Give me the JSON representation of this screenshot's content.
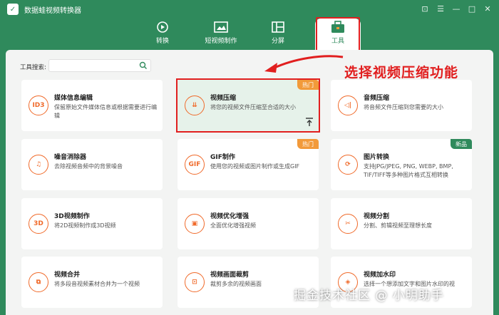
{
  "app": {
    "title": "数据蛙视频转换器",
    "logo_glyph": "✓"
  },
  "window_controls": [
    "⊡",
    "☰",
    "—",
    "□",
    "✕"
  ],
  "nav_tabs": [
    {
      "label": "转换",
      "icon": "convert-icon"
    },
    {
      "label": "短视频制作",
      "icon": "short-video-icon"
    },
    {
      "label": "分屏",
      "icon": "split-screen-icon"
    },
    {
      "label": "工具",
      "icon": "toolbox-icon",
      "active": true
    }
  ],
  "search": {
    "label": "工具搜索:",
    "placeholder": ""
  },
  "annotation": "选择视频压缩功能",
  "tools": [
    {
      "title": "媒体信息编辑",
      "desc": "保留原始文件媒体信息或根据需要进行编辑",
      "icon_text": "ID3"
    },
    {
      "title": "视频压缩",
      "desc": "将您的视频文件压缩至合适的大小",
      "icon_text": "⇊",
      "badge": "热门",
      "highlight": true
    },
    {
      "title": "音频压缩",
      "desc": "将音频文件压缩到您需要的大小",
      "icon_text": "◁|"
    },
    {
      "title": "噪音消除器",
      "desc": "去除视频音频中的背景噪音",
      "icon_text": "♫"
    },
    {
      "title": "GIF制作",
      "desc": "使用您的视频或图片制作或生成GIF",
      "icon_text": "GIF",
      "badge": "热门"
    },
    {
      "title": "图片转换",
      "desc": "支持JPG/JPEG, PNG, WEBP, BMP, TIF/TIFF等多种图片格式互相转换",
      "icon_text": "⟳",
      "badge": "新品"
    },
    {
      "title": "3D视频制作",
      "desc": "将2D视频制作成3D视频",
      "icon_text": "3D"
    },
    {
      "title": "视频优化增强",
      "desc": "全面优化增强视频",
      "icon_text": "▣"
    },
    {
      "title": "视频分割",
      "desc": "分割、剪辑视频至理想长度",
      "icon_text": "✂"
    },
    {
      "title": "视频合并",
      "desc": "将多段音视频素材合并为一个视频",
      "icon_text": "⧉"
    },
    {
      "title": "视频画面裁剪",
      "desc": "裁剪多余的视频画面",
      "icon_text": "⊡"
    },
    {
      "title": "视频加水印",
      "desc": "选择一个想添加文字和图片水印的视",
      "icon_text": "◈"
    }
  ],
  "watermark": "掘金技术社区 @ 小明助手",
  "colors": {
    "brand": "#2f8a5c",
    "accent": "#f06a2a",
    "hot": "#f29a3a",
    "annotation": "#e11f1f"
  }
}
